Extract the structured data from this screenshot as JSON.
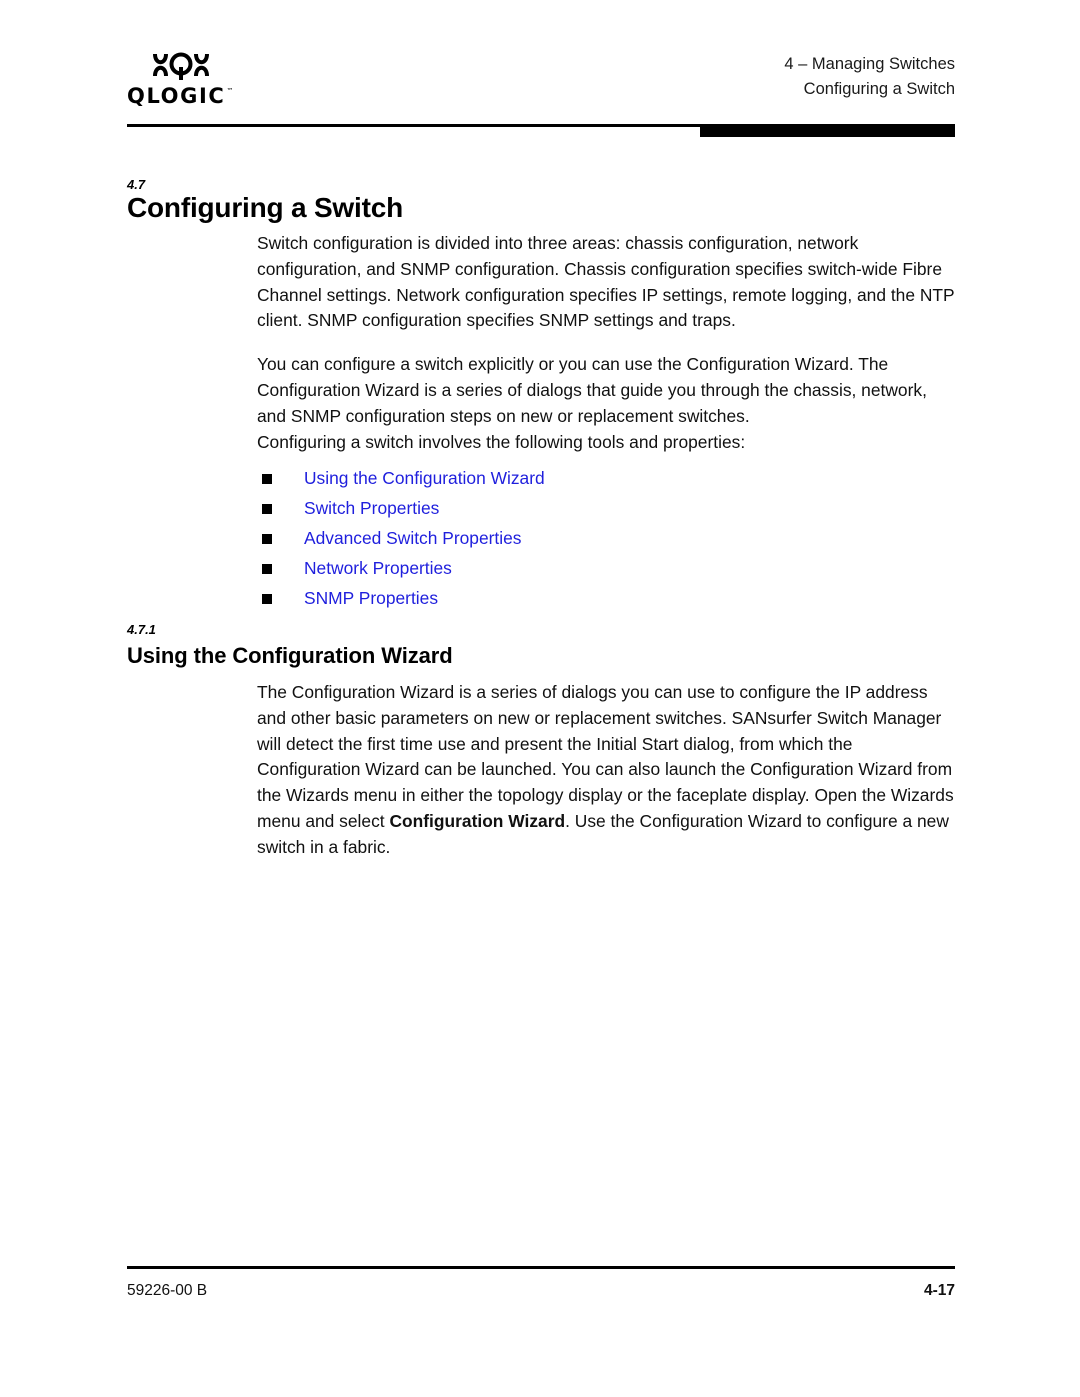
{
  "header": {
    "chapter_line": "4 – Managing Switches",
    "section_line": "Configuring a Switch",
    "logo_wordmark": "QLOGIC",
    "logo_tm": "™"
  },
  "section": {
    "number": "4.7",
    "title": "Configuring a Switch",
    "paragraph_1": "Switch configuration is divided into three areas: chassis configuration, network configuration, and SNMP configuration. Chassis configuration specifies switch-wide Fibre Channel settings. Network configuration specifies IP settings, remote logging, and the NTP client. SNMP configuration specifies SNMP settings and traps.",
    "paragraph_2": "You can configure a switch explicitly or you can use the Configuration Wizard. The Configuration Wizard is a series of dialogs that guide you through the chassis, network, and SNMP configuration steps on new or replacement switches.",
    "paragraph_3": "Configuring a switch involves the following tools and properties:"
  },
  "links": [
    {
      "label": "Using the Configuration Wizard"
    },
    {
      "label": "Switch Properties"
    },
    {
      "label": "Advanced Switch Properties"
    },
    {
      "label": "Network Properties"
    },
    {
      "label": "SNMP Properties"
    }
  ],
  "subsection": {
    "number": "4.7.1",
    "title": "Using the Configuration Wizard",
    "paragraph_1_part1": "The Configuration Wizard is a series of dialogs you can use to configure the IP address and other basic parameters on new or replacement switches. SANsurfer Switch Manager will detect the first time use and present the Initial Start dialog, from which the Configuration Wizard can be launched. You can also launch the Configuration Wizard from the Wizards menu in either the topology display or the faceplate display. Open the Wizards menu and select ",
    "paragraph_1_bold": "Configuration Wizard",
    "paragraph_1_part2": ". Use the Configuration Wizard to configure a new switch in a fabric."
  },
  "footer": {
    "document_number": "59226-00 B",
    "page_number": "4-17"
  },
  "colors": {
    "link_blue": "#1f1fdd",
    "rule_black": "#000000",
    "text_black": "#111111"
  }
}
